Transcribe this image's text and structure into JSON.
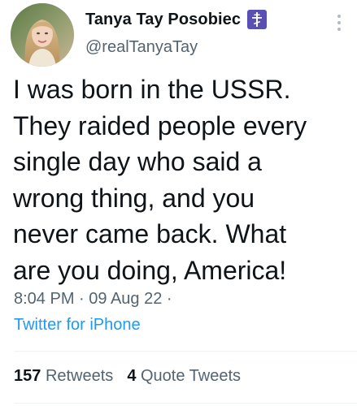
{
  "author": {
    "display_name": "Tanya Tay Posobiec",
    "handle": "@realTanyaTay",
    "badge_icon": "orthodox-cross-icon",
    "badge_color": "#5a4fb5"
  },
  "tweet": {
    "text": "I was born in the USSR.\nThey raided people every\nsingle day who said a\nwrong thing, and you\nnever came back. What\nare you doing, America!",
    "time": "8:04 PM",
    "date": "09 Aug 22",
    "source": "Twitter for iPhone"
  },
  "stats": {
    "retweets_count": "157",
    "retweets_label": "Retweets",
    "quotes_count": "4",
    "quotes_label": "Quote Tweets"
  },
  "colors": {
    "text": "#0f1419",
    "secondary": "#536471",
    "link": "#1d9bf0",
    "divider": "#eff3f4"
  },
  "icons": {
    "more": "more-vertical-icon"
  }
}
